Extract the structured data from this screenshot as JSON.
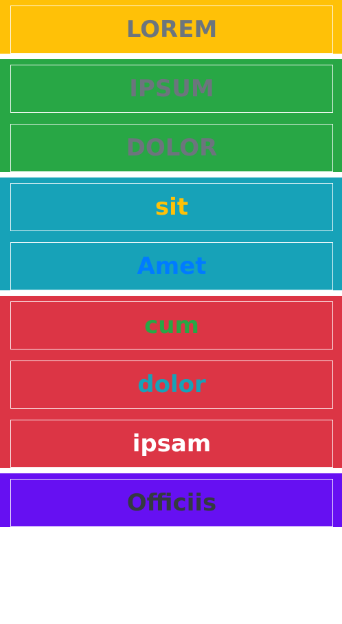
{
  "groups": [
    {
      "name": "yellow",
      "background": "#FFC107",
      "items": [
        {
          "label": "LOREM",
          "color": "#6C757D"
        }
      ]
    },
    {
      "name": "green",
      "background": "#28A745",
      "items": [
        {
          "label": "IPSUM",
          "color": "#6C757D"
        },
        {
          "label": "DOLOR",
          "color": "#6C757D"
        }
      ]
    },
    {
      "name": "teal",
      "background": "#17A2B8",
      "items": [
        {
          "label": "sit",
          "color": "#FFC107"
        },
        {
          "label": "Amet",
          "color": "#007BFF"
        }
      ]
    },
    {
      "name": "red",
      "background": "#DC3545",
      "items": [
        {
          "label": "cum",
          "color": "#28A745"
        },
        {
          "label": "dolor",
          "color": "#17A2B8"
        },
        {
          "label": "ipsam",
          "color": "#FFFFFF"
        }
      ]
    },
    {
      "name": "purple",
      "background": "#6610F2",
      "items": [
        {
          "label": "Officiis",
          "color": "#343A40"
        }
      ]
    }
  ]
}
